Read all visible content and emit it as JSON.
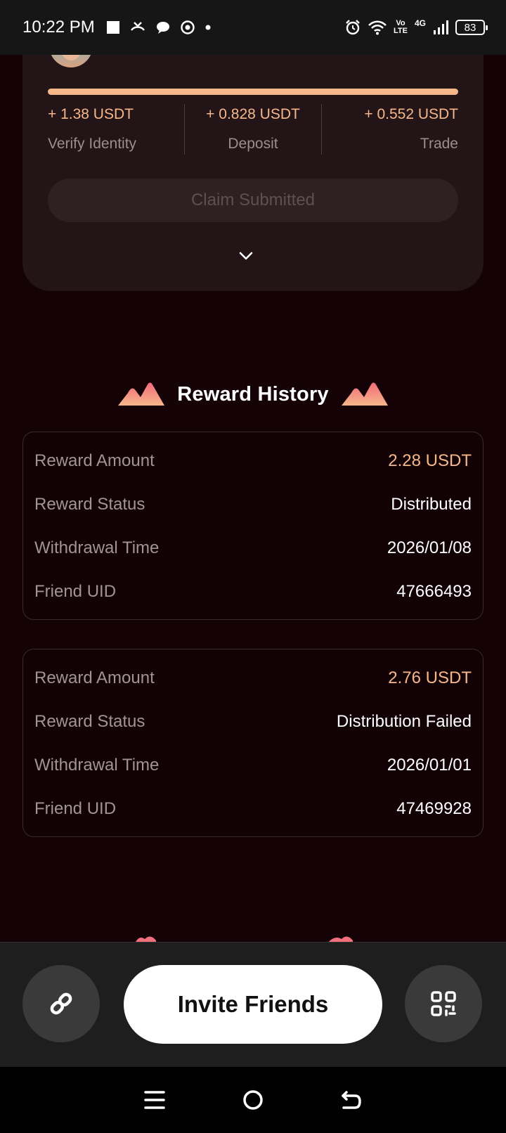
{
  "status_bar": {
    "time": "10:22 PM",
    "volte_line1": "Vo",
    "volte_line2": "LTE",
    "network": "4G",
    "battery": "83"
  },
  "task_card": {
    "progress_percent": 100,
    "tasks": [
      {
        "amount": "+ 1.38 USDT",
        "label": "Verify Identity"
      },
      {
        "amount": "+ 0.828 USDT",
        "label": "Deposit"
      },
      {
        "amount": "+ 0.552 USDT",
        "label": "Trade"
      }
    ],
    "claim_label": "Claim Submitted"
  },
  "reward_history": {
    "title": "Reward History",
    "records": [
      {
        "amount_label": "Reward Amount",
        "amount": "2.28 USDT",
        "status_label": "Reward Status",
        "status": "Distributed",
        "time_label": "Withdrawal Time",
        "time": "2026/01/08",
        "uid_label": "Friend UID",
        "uid": "47666493"
      },
      {
        "amount_label": "Reward Amount",
        "amount": "2.76 USDT",
        "status_label": "Reward Status",
        "status": "Distribution Failed",
        "time_label": "Withdrawal Time",
        "time": "2026/01/01",
        "uid_label": "Friend UID",
        "uid": "47469928"
      }
    ]
  },
  "action_bar": {
    "invite_label": "Invite Friends"
  },
  "colors": {
    "accent": "#f6b78a",
    "background": "#140206",
    "card": "#221417"
  }
}
